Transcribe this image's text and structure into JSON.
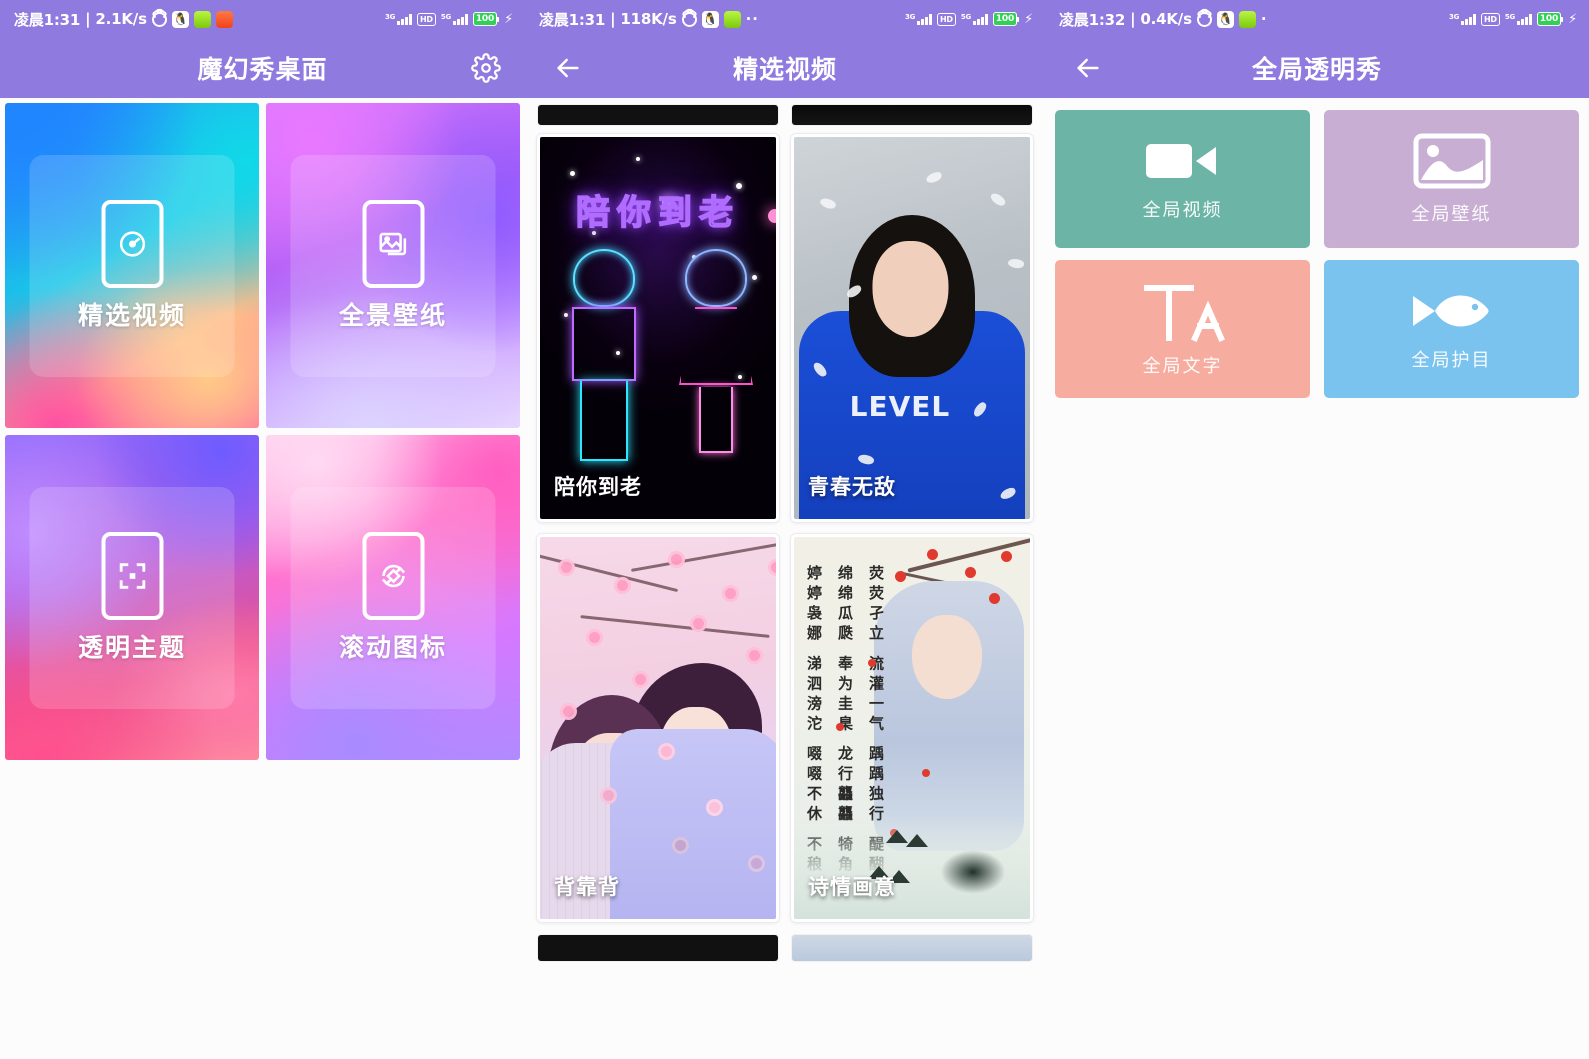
{
  "panels": [
    {
      "status": {
        "time": "凌晨1:31",
        "sep": "|",
        "speed": "2.1K/s",
        "icons": [
          "alarm-icon",
          "qq-icon",
          "green-app-icon",
          "orange-app-icon"
        ],
        "overflow": "",
        "net1": "3G",
        "hd": "HD",
        "net2": "5G",
        "battery": "100",
        "charging": "⚡"
      },
      "appbar": {
        "title": "魔幻秀桌面",
        "gear": "settings-icon"
      },
      "cards": [
        {
          "label": "精选视频",
          "icon": "speedometer-phone-icon"
        },
        {
          "label": "全景壁纸",
          "icon": "image-phone-icon"
        },
        {
          "label": "透明主题",
          "icon": "focus-frame-phone-icon"
        },
        {
          "label": "滚动图标",
          "icon": "rotate-phone-icon"
        }
      ]
    },
    {
      "status": {
        "time": "凌晨1:31",
        "sep": "|",
        "speed": "118K/s",
        "icons": [
          "alarm-icon",
          "qq-icon",
          "green-app-icon"
        ],
        "overflow": "··",
        "net1": "3G",
        "hd": "HD",
        "net2": "5G",
        "battery": "100",
        "charging": "⚡"
      },
      "appbar": {
        "title": "精选视频",
        "back": "back-arrow-icon"
      },
      "videos": [
        {
          "caption": "陪你到老",
          "art": "neon",
          "overlay_title": "陪你到老"
        },
        {
          "caption": "青春无敌",
          "art": "girl",
          "overlay_title": "LEVEL"
        },
        {
          "caption": "背靠背",
          "art": "sakura"
        },
        {
          "caption": "诗情画意",
          "art": "ink",
          "poem": [
            "荧荧孑立 流灌一气 踽踽独行 醍醐灌顶",
            "绵绵瓜瓞 奉为圭臬 龙行龘龘 犄角旮旯",
            "婷婷袅娜 涕泗滂沱 啜啜不休 不稂不莠"
          ]
        }
      ]
    },
    {
      "status": {
        "time": "凌晨1:32",
        "sep": "|",
        "speed": "0.4K/s",
        "icons": [
          "alarm-icon",
          "qq-icon",
          "green-app-icon"
        ],
        "overflow": "·",
        "net1": "3G",
        "hd": "HD",
        "net2": "5G",
        "battery": "100",
        "charging": "⚡"
      },
      "appbar": {
        "title": "全局透明秀",
        "back": "back-arrow-icon"
      },
      "tiles": [
        {
          "label": "全局视频",
          "icon": "video-camera-icon",
          "color": "#6cb5a6"
        },
        {
          "label": "全局壁纸",
          "icon": "picture-icon",
          "color": "#c9aed4"
        },
        {
          "label": "全局文字",
          "icon": "text-ta-icon",
          "color": "#f6ada0"
        },
        {
          "label": "全局护目",
          "icon": "fish-icon",
          "color": "#79c3ee"
        }
      ]
    }
  ],
  "theme": {
    "purple": "#8f7ae0",
    "page_bg": "#fcfcfd"
  }
}
